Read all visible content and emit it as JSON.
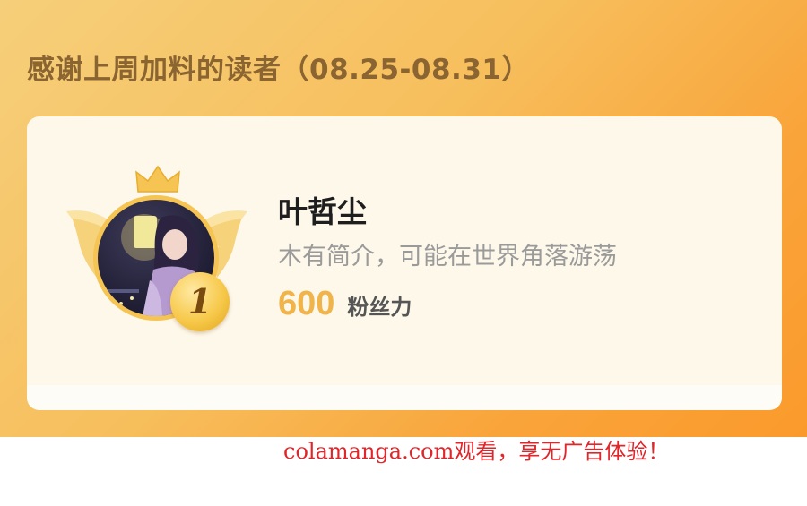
{
  "header": {
    "title": "感谢上周加料的读者（08.25-08.31）"
  },
  "top_reader": {
    "rank": "1",
    "name": "叶哲尘",
    "bio": "木有简介，可能在世界角落游荡",
    "fan_power_value": "600",
    "fan_power_label": "粉丝力"
  },
  "watermark": {
    "text": "colamanga.com观看，享无广告体验！"
  },
  "icons": [
    "crown-icon",
    "wings-icon",
    "rank-medal-icon"
  ],
  "colors": {
    "banner_start": "#f6cf7a",
    "banner_end": "#fb9a2c",
    "heading": "#8a6431",
    "card_bg": "#fdf8ea",
    "gold": "#f5c453",
    "fan_value": "#f0b44a",
    "watermark": "#e0262a"
  }
}
